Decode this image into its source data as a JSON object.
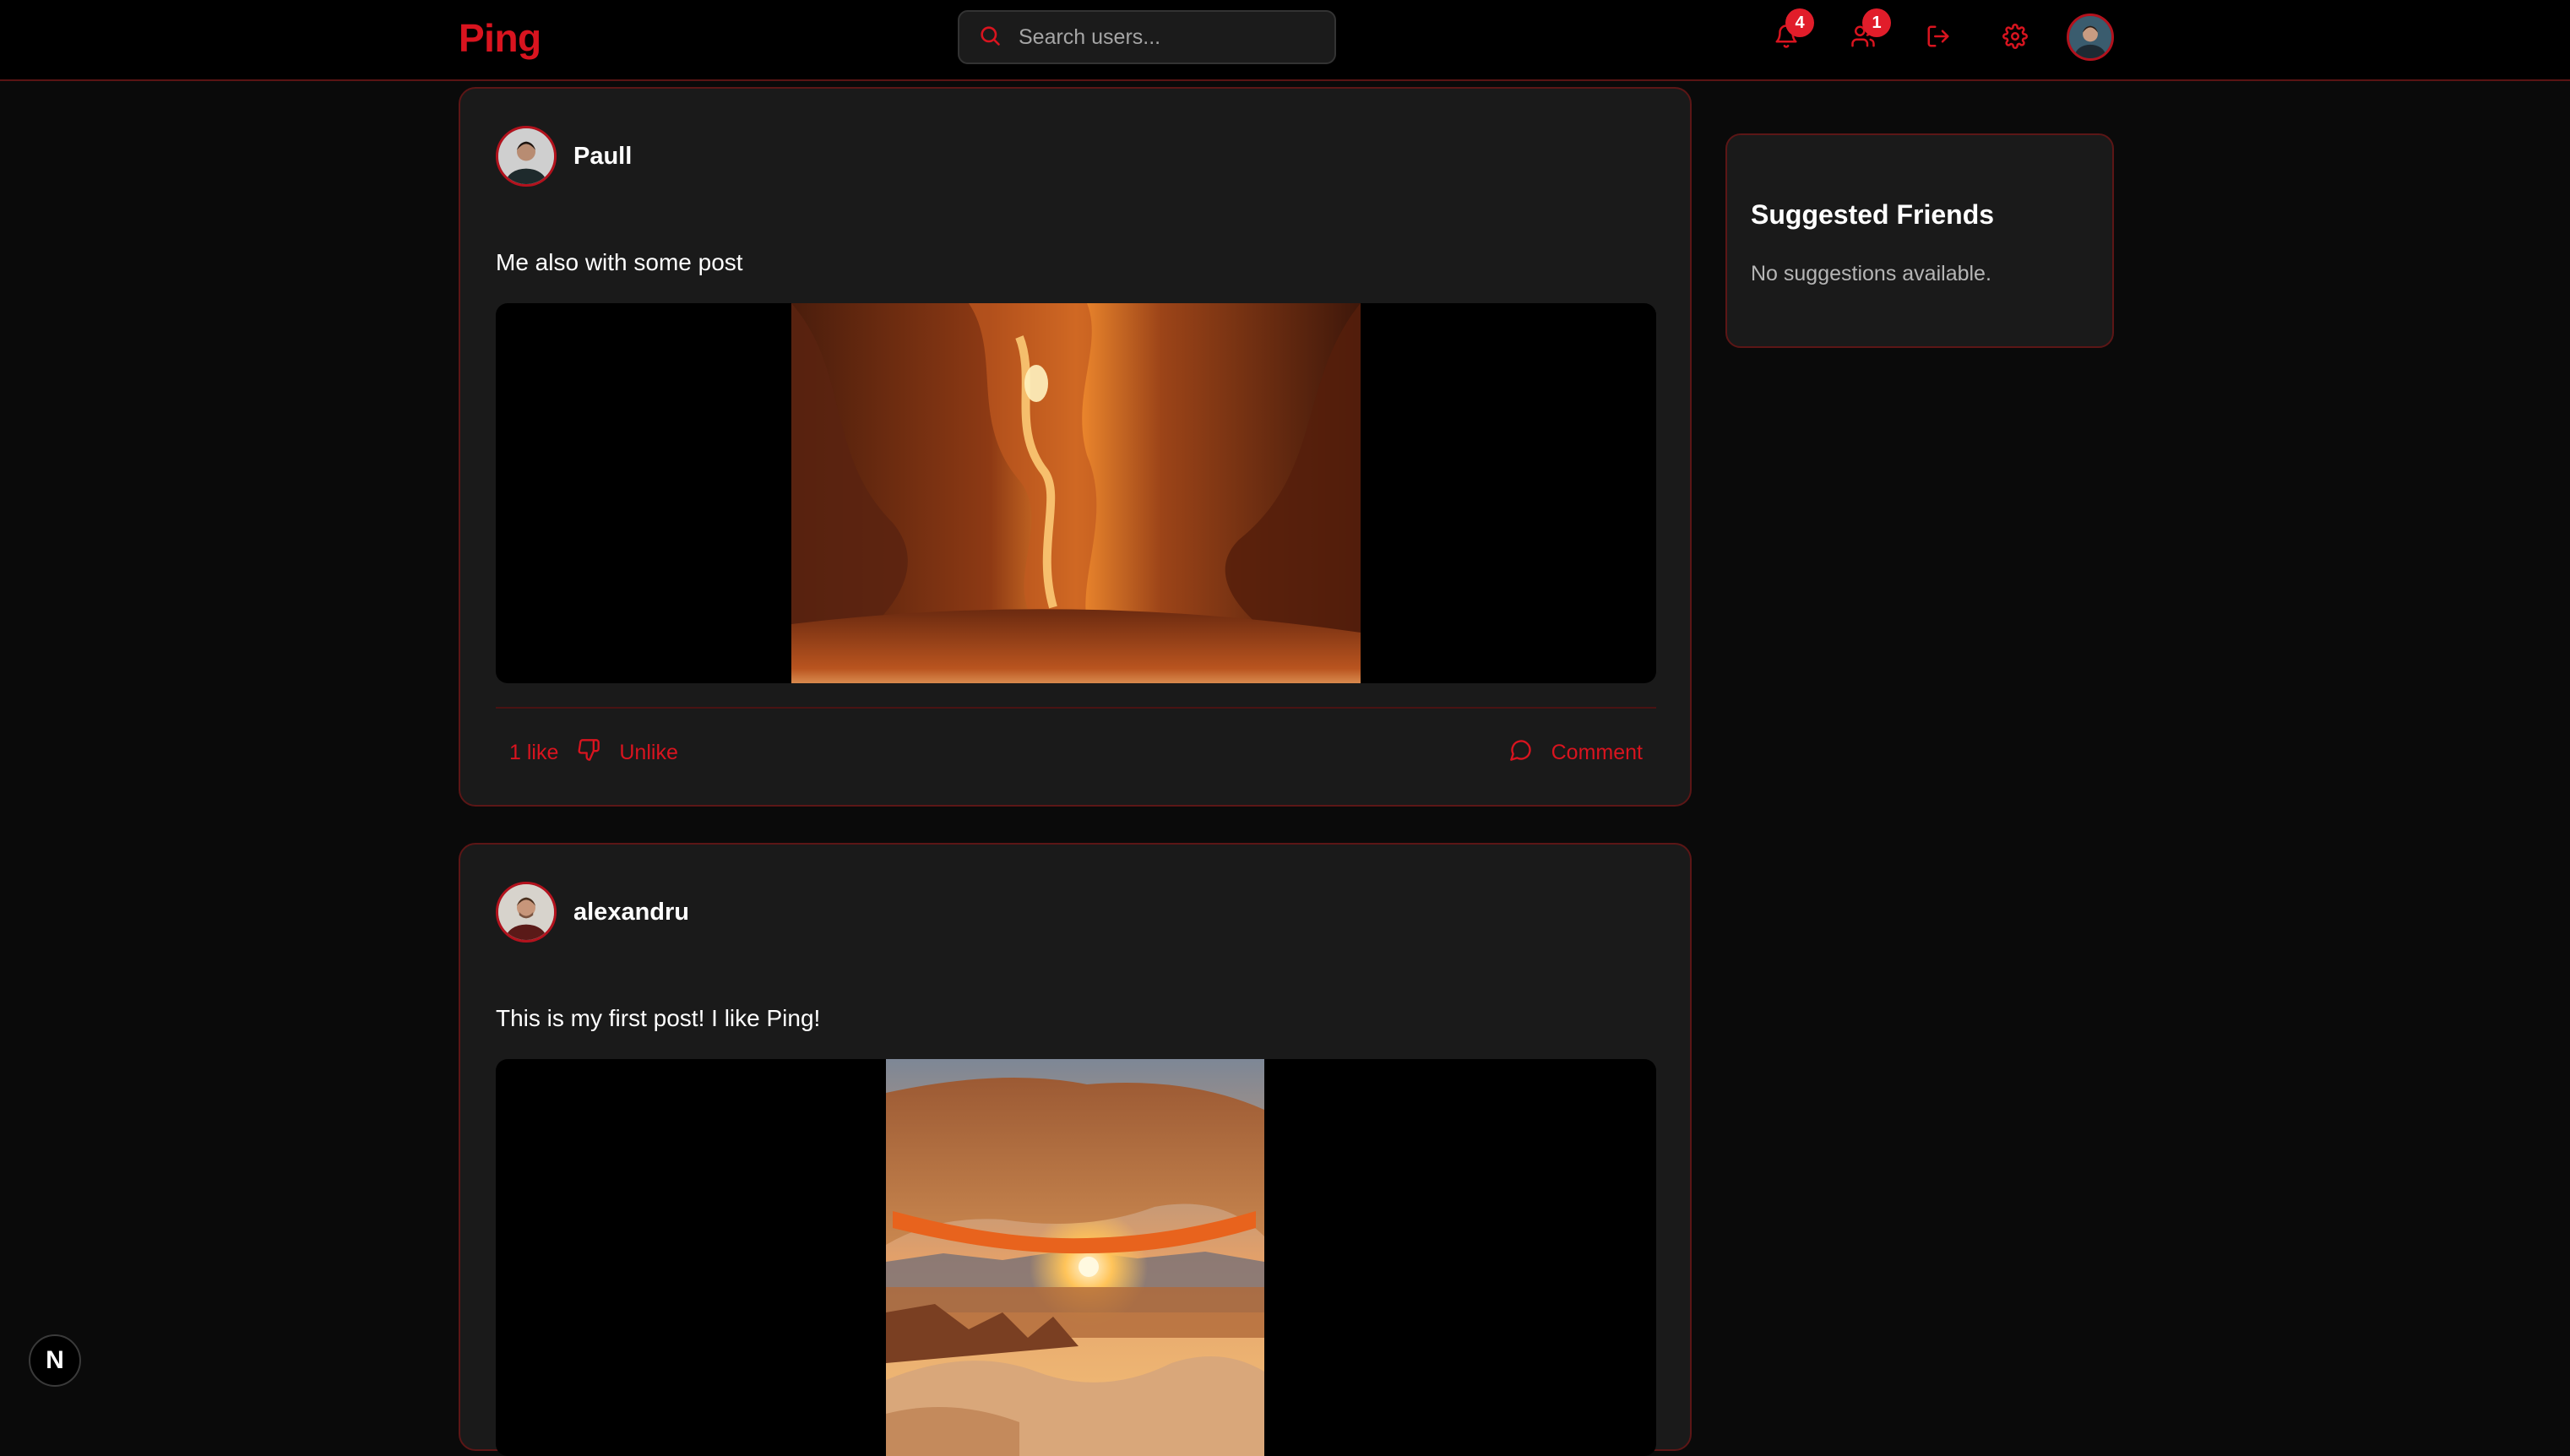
{
  "header": {
    "logo": "Ping",
    "search_placeholder": "Search users...",
    "notifications_count": "4",
    "friend_requests_count": "1"
  },
  "posts": [
    {
      "author": "Paull",
      "text": "Me also with some post",
      "image": "slot-canyon-photo",
      "likes_label": "1 like",
      "unlike_label": "Unlike",
      "comment_label": "Comment"
    },
    {
      "author": "alexandru",
      "text": "This is my first post! I like Ping!",
      "image": "arch-sunrise-photo"
    }
  ],
  "sidebar": {
    "title": "Suggested Friends",
    "empty_text": "No suggestions available."
  },
  "dev_badge": "N",
  "colors": {
    "accent": "#d9141f",
    "badge": "#e11d2a",
    "background": "#0a0a0a",
    "card": "#1a1a1a",
    "card_border": "#5c1616"
  }
}
